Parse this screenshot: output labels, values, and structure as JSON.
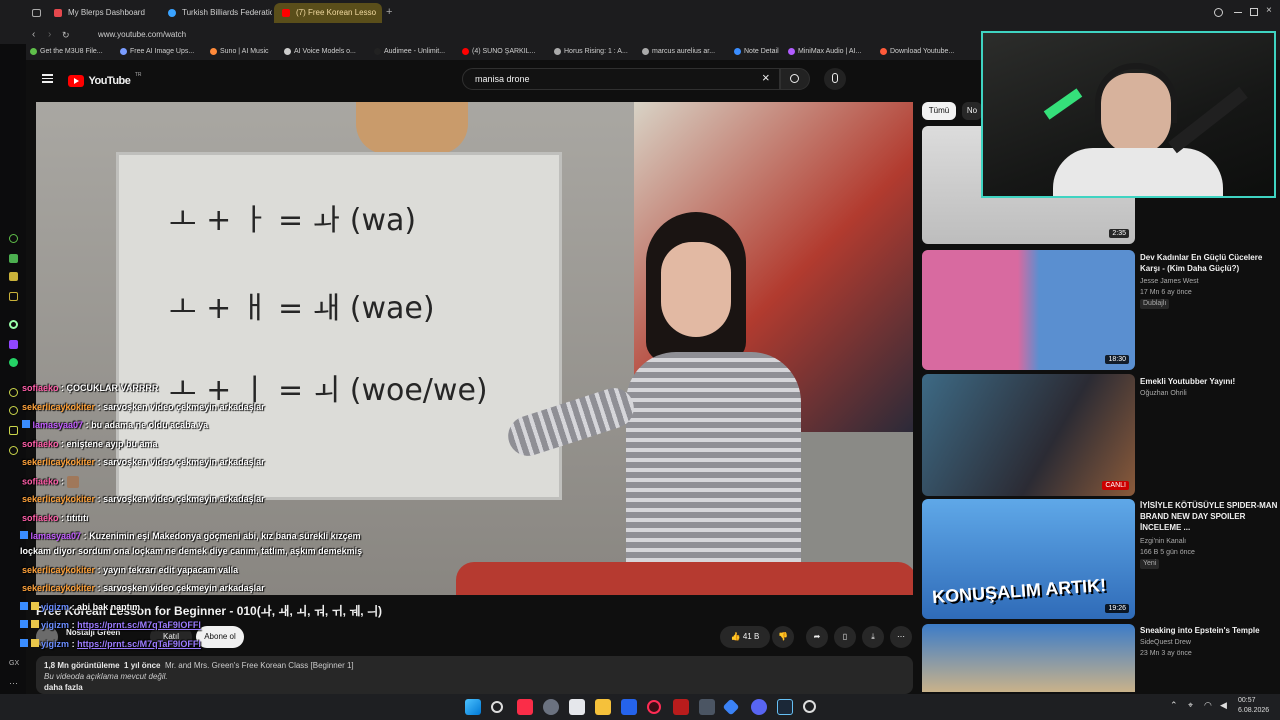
{
  "browser": {
    "tabs": [
      {
        "label": "My Blerps Dashboard",
        "color": "#e5484d"
      },
      {
        "label": "Turkish Billiards Federation",
        "color": "#3aa3ff"
      },
      {
        "label": "(7) Free Korean Lesso",
        "color": "#ff0000"
      }
    ],
    "url": "www.youtube.com/watch",
    "bookmarks": [
      {
        "label": "Get the M3U8 File...",
        "color": "#5fbf4a"
      },
      {
        "label": "Free AI Image Ups...",
        "color": "#7a9cff"
      },
      {
        "label": "Suno | AI Music",
        "color": "#ff8a3a"
      },
      {
        "label": "AI Voice Models o...",
        "color": "#cccccc"
      },
      {
        "label": "Audimee - Unlimit...",
        "color": "#222222"
      },
      {
        "label": "(4) SUNO ŞARKIL...",
        "color": "#ff0000"
      },
      {
        "label": "Horus Rising: 1 : A...",
        "color": "#aaaaaa"
      },
      {
        "label": "marcus aurelius ar...",
        "color": "#aaaaaa"
      },
      {
        "label": "Note Detail",
        "color": "#3a8dff"
      },
      {
        "label": "MiniMax Audio | AI...",
        "color": "#b15cff"
      },
      {
        "label": "Download Youtube...",
        "color": "#ff5a3a"
      }
    ]
  },
  "youtube": {
    "logo_text": "YouTube",
    "logo_suffix": "TR",
    "search_value": "manisa drone",
    "video": {
      "board_lines": [
        "ㅗ  +  ㅏ  = ㅘ (wa)",
        "ㅗ  +  ㅐ  = ㅙ (wae)",
        "ㅗ  +  ㅣ  = ㅚ (woe/we)"
      ],
      "title": "Free Korean Lesson for Beginner - 010(ㅘ, ㅙ, ㅚ, ㅝ, ㅟ, ㅞ, ㅢ)",
      "channel": "Nostalji Green",
      "join_label": "Katıl",
      "subscribe_label": "Abone ol",
      "likes": "41 B",
      "views": "1,8 Mn görüntüleme",
      "age": "1 yıl önce",
      "playlist": "Mr. and Mrs. Green's Free Korean Class [Beginner 1]",
      "description": "Bu videoda açıklama mevcut değil.",
      "more": "daha fazla"
    },
    "chips": [
      "Tümü",
      "No"
    ],
    "sidebar": [
      {
        "title": "",
        "channel": "",
        "meta": "",
        "badge": "",
        "duration": "2:35"
      },
      {
        "title": "Dev Kadınlar En Güçlü Cücelere Karşı - (Kim Daha Güçlü?)",
        "channel": "Jesse James West",
        "meta": "17 Mn  6 ay önce",
        "badge": "Dublajlı",
        "duration": "18:30"
      },
      {
        "title": "Emekli Youtubber Yayını!",
        "channel": "Oğuzhan Ohrili",
        "meta": "",
        "badge": "",
        "duration": "CANLI"
      },
      {
        "title": "İYİSİYLE KÖTÜSÜYLE SPIDER-MAN BRAND NEW DAY SPOILER İNCELEME ...",
        "channel": "Ezgi'nin Kanalı",
        "meta": "166 B  5 gün önce",
        "badge": "Yeni",
        "duration": "19:26"
      },
      {
        "title": "Sneaking into Epstein's Temple",
        "channel": "SideQuest Drew",
        "meta": "23 Mn  3 ay önce",
        "badge": "",
        "duration": ""
      }
    ],
    "thumb_text": "KONUŞALIM ARTIK!"
  },
  "chat": [
    {
      "user": "sofiaeko",
      "color": "pink",
      "msg": ": ÇOCUKLAR VARRRR"
    },
    {
      "user": "sekerlicaykokiter",
      "color": "orange",
      "msg": ": sarvoşken video çekmeyin arkadaşlar"
    },
    {
      "user": "lamasyaa07",
      "color": "purple",
      "msg": ": bu adama ne oldu acaba ya"
    },
    {
      "user": "sofiaeko",
      "color": "pink",
      "msg": ": eniştene ayıp bu ama"
    },
    {
      "user": "sekerlicaykokiter",
      "color": "orange",
      "msg": ": sarvoşken video çekmeyin arkadaşlar"
    },
    {
      "user": "sofiaeko",
      "color": "pink",
      "msg": ":"
    },
    {
      "user": "sekerlicaykokiter",
      "color": "orange",
      "msg": ": sarvoşken video çekmeyin arkadaşlar"
    },
    {
      "user": "sofiaeko",
      "color": "pink",
      "msg": ": tıtıtıtı"
    },
    {
      "user": "lamasyaa07",
      "color": "purple",
      "msg": ": Kuzenimin eşi Makedonya göçmeni abi, kız bana sürekli kızçem"
    },
    {
      "user": "",
      "color": "",
      "msg": "loçkam diyor sordum ona loçkam ne demek diye canım, tatlım, aşkım demekmiş"
    },
    {
      "user": "sekerlicaykokiter",
      "color": "orange",
      "msg": ": yayın tekrarı edit yapacam valla"
    },
    {
      "user": "sekerlicaykokiter",
      "color": "orange",
      "msg": ": sarvoşken video çekmeyin arkadaşlar"
    },
    {
      "user": "yigizm",
      "color": "blue",
      "msg": ": abi bak naptım"
    },
    {
      "user": "yigizm",
      "color": "blue",
      "msg": ":",
      "link": "https://prnt.sc/M7qTaF9lOFFl"
    },
    {
      "user": "yigizm",
      "color": "blue",
      "msg": ":",
      "link": "https://prnt.sc/M7qTaF9lOFFl"
    }
  ],
  "taskbar": {
    "time": "00:57",
    "date": "6.08.2026"
  }
}
